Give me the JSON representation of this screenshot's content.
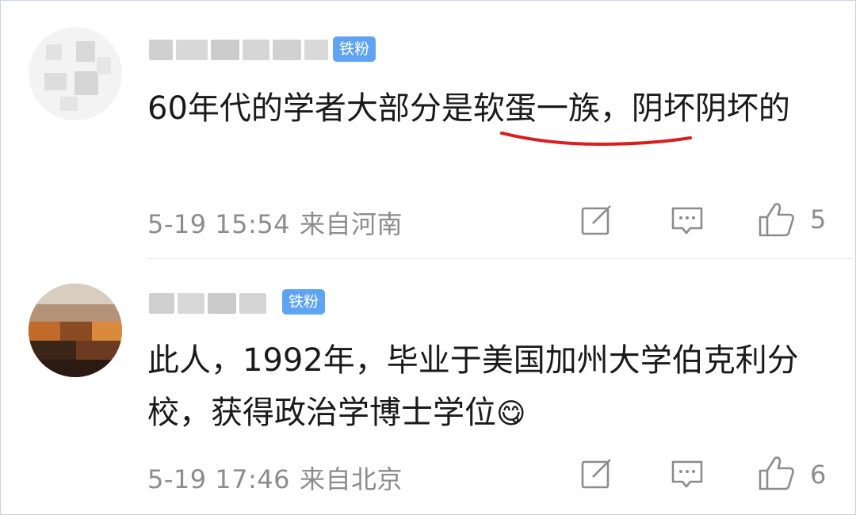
{
  "comments": [
    {
      "badge": "铁粉",
      "text_prefix": "60年代的学者大部分是",
      "text_highlight": "软蛋一族",
      "text_suffix": "，阴坏阴坏的",
      "date": "5-19 15:54",
      "location": "来自河南",
      "likes": "5"
    },
    {
      "badge": "铁粉",
      "text": "此人，1992年，毕业于美国加州大学伯克利分校，获得政治学博士学位",
      "emoji": "😋",
      "date": "5-19 17:46",
      "location": "来自北京",
      "likes": "6"
    }
  ],
  "colors": {
    "badge": "#5fa4f2",
    "meta": "#8c8c8c",
    "text": "#1a1a1a",
    "underline": "#d81e1e"
  },
  "icons": [
    "edit-icon",
    "comment-icon",
    "thumbs-up-icon"
  ]
}
